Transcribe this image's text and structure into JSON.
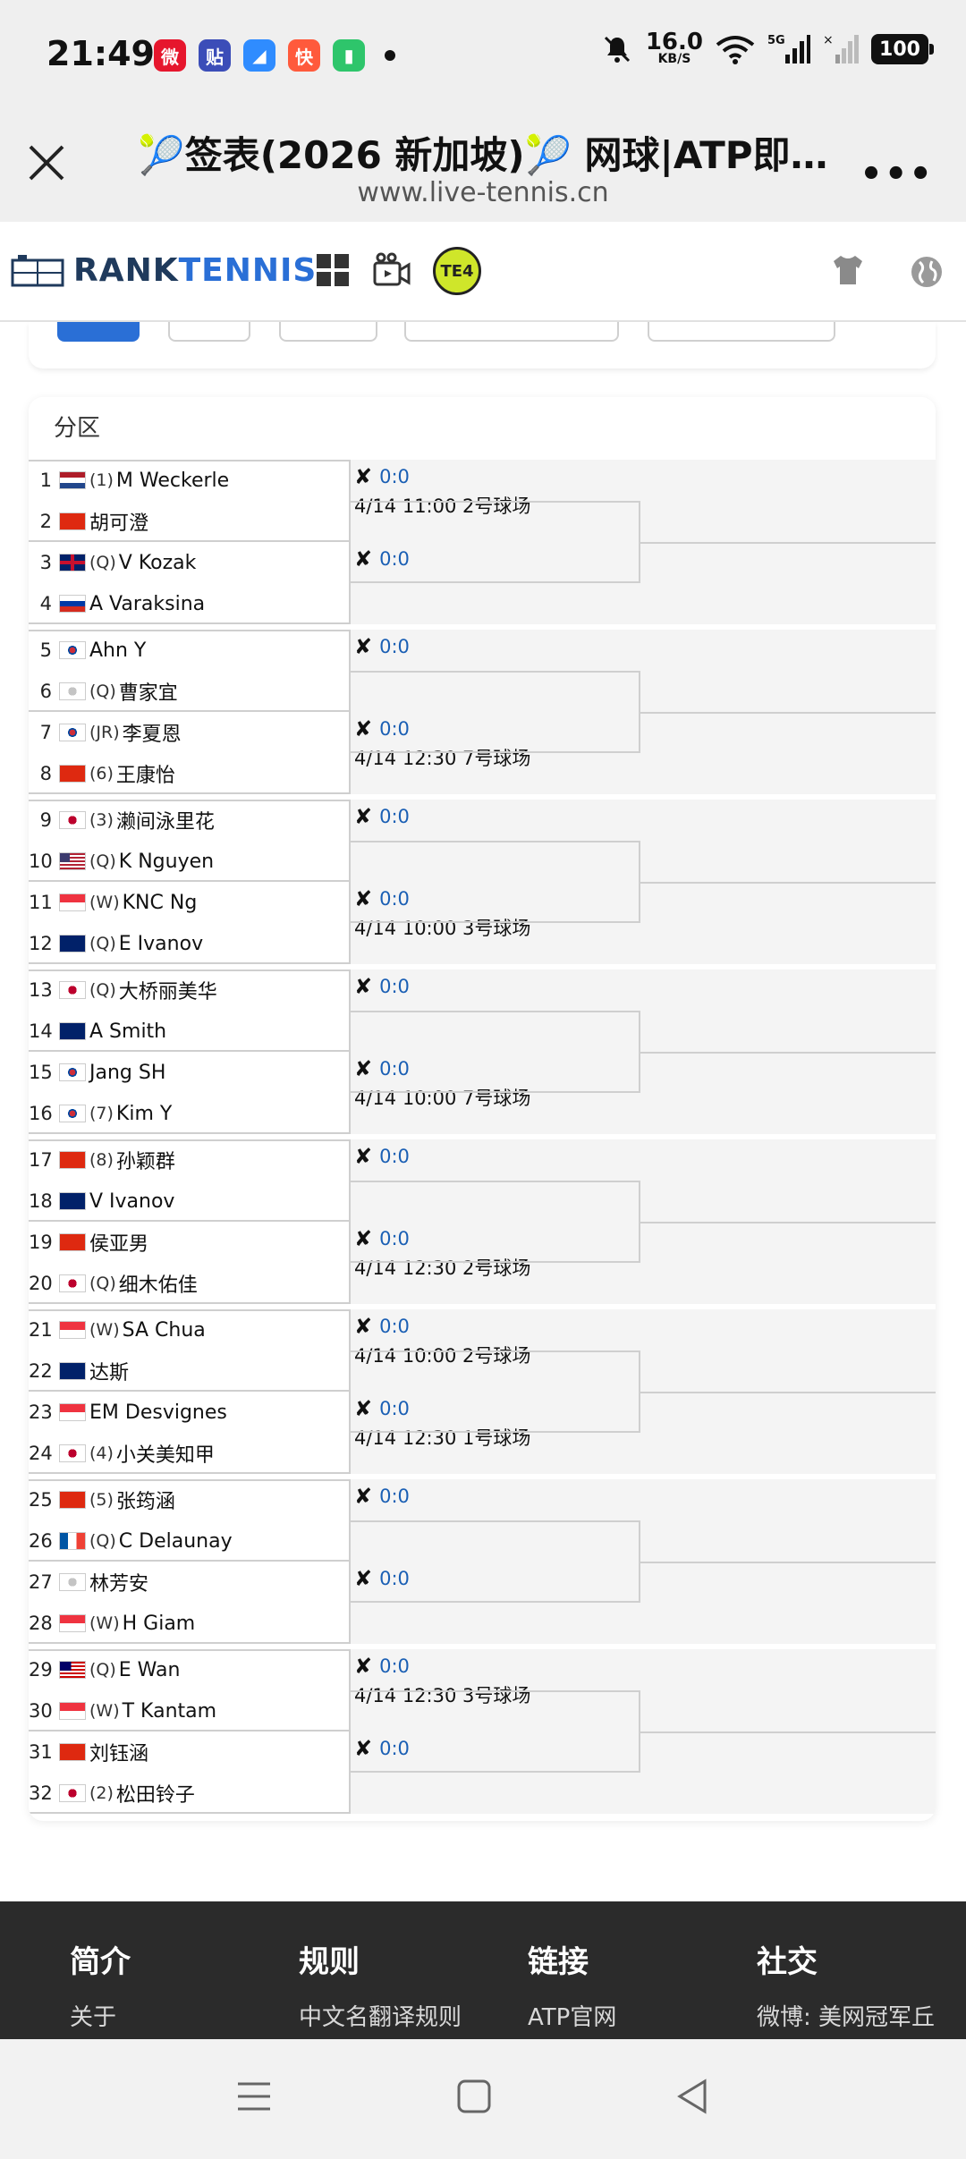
{
  "status": {
    "time": "21:49",
    "speed_value": "16.0",
    "speed_unit": "KB/S",
    "network": "5G",
    "battery": "100"
  },
  "browser": {
    "title": "🎾签表(2026 新加坡)🎾 网球|ATP即…",
    "url": "www.live-tennis.cn"
  },
  "site": {
    "logo_prefix": "RANK",
    "logo_suffix": "TENNIS",
    "badge": "TE4"
  },
  "bracket": {
    "heading": "分区",
    "score_default": "0:0",
    "players": [
      {
        "n": "1",
        "flag": "nl",
        "tag": "(1)",
        "name": "M Weckerle"
      },
      {
        "n": "2",
        "flag": "hk",
        "tag": "",
        "name": "胡可澄"
      },
      {
        "n": "3",
        "flag": "gb",
        "tag": "(Q)",
        "name": "V Kozak"
      },
      {
        "n": "4",
        "flag": "ru",
        "tag": "",
        "name": "A Varaksina"
      },
      {
        "n": "5",
        "flag": "kr",
        "tag": "",
        "name": "Ahn Y"
      },
      {
        "n": "6",
        "flag": "tw",
        "tag": "(Q)",
        "name": "曹家宜"
      },
      {
        "n": "7",
        "flag": "kr",
        "tag": "(JR)",
        "name": "李夏恩"
      },
      {
        "n": "8",
        "flag": "hk",
        "tag": "(6)",
        "name": "王康怡"
      },
      {
        "n": "9",
        "flag": "jp",
        "tag": "(3)",
        "name": "濑间泳里花"
      },
      {
        "n": "10",
        "flag": "us",
        "tag": "(Q)",
        "name": "K Nguyen"
      },
      {
        "n": "11",
        "flag": "sg",
        "tag": "(W)",
        "name": "KNC Ng"
      },
      {
        "n": "12",
        "flag": "au",
        "tag": "(Q)",
        "name": "E Ivanov"
      },
      {
        "n": "13",
        "flag": "jp",
        "tag": "(Q)",
        "name": "大桥丽美华"
      },
      {
        "n": "14",
        "flag": "au",
        "tag": "",
        "name": "A Smith"
      },
      {
        "n": "15",
        "flag": "kr",
        "tag": "",
        "name": "Jang SH"
      },
      {
        "n": "16",
        "flag": "kr",
        "tag": "(7)",
        "name": "Kim Y"
      },
      {
        "n": "17",
        "flag": "cn",
        "tag": "(8)",
        "name": "孙颖群"
      },
      {
        "n": "18",
        "flag": "nz",
        "tag": "",
        "name": "V Ivanov"
      },
      {
        "n": "19",
        "flag": "cn",
        "tag": "",
        "name": "侯亚男"
      },
      {
        "n": "20",
        "flag": "jp",
        "tag": "(Q)",
        "name": "细木佑佳"
      },
      {
        "n": "21",
        "flag": "sg",
        "tag": "(W)",
        "name": "SA Chua"
      },
      {
        "n": "22",
        "flag": "nz",
        "tag": "",
        "name": "达斯"
      },
      {
        "n": "23",
        "flag": "sg",
        "tag": "",
        "name": "EM Desvignes"
      },
      {
        "n": "24",
        "flag": "jp",
        "tag": "(4)",
        "name": "小关美知甲"
      },
      {
        "n": "25",
        "flag": "cn",
        "tag": "(5)",
        "name": "张筠涵"
      },
      {
        "n": "26",
        "flag": "fr",
        "tag": "(Q)",
        "name": "C Delaunay"
      },
      {
        "n": "27",
        "flag": "tw",
        "tag": "",
        "name": "林芳安"
      },
      {
        "n": "28",
        "flag": "sg",
        "tag": "(W)",
        "name": "H Giam"
      },
      {
        "n": "29",
        "flag": "my",
        "tag": "(Q)",
        "name": "E Wan"
      },
      {
        "n": "30",
        "flag": "sg",
        "tag": "(W)",
        "name": "T Kantam"
      },
      {
        "n": "31",
        "flag": "cn",
        "tag": "",
        "name": "刘钰涵"
      },
      {
        "n": "32",
        "flag": "jp",
        "tag": "(2)",
        "name": "松田铃子"
      }
    ],
    "schedules": [
      {
        "pair": 0,
        "text": "4/14 11:00 2号球场"
      },
      {
        "pair": 3,
        "text": "4/14 12:30 7号球场"
      },
      {
        "pair": 5,
        "text": "4/14 10:00 3号球场"
      },
      {
        "pair": 7,
        "text": "4/14 10:00 7号球场"
      },
      {
        "pair": 9,
        "text": "4/14 12:30 2号球场"
      },
      {
        "pair": 10,
        "text": "4/14 10:00 2号球场"
      },
      {
        "pair": 11,
        "text": "4/14 12:30 1号球场"
      },
      {
        "pair": 14,
        "text": "4/14 12:30 3号球场"
      }
    ]
  },
  "footer": {
    "columns": [
      {
        "heading": "简介",
        "link": "关于"
      },
      {
        "heading": "规则",
        "link": "中文名翻译规则"
      },
      {
        "heading": "链接",
        "link": "ATP官网"
      },
      {
        "heading": "社交",
        "link": "微博: 美网冠军丘"
      }
    ]
  },
  "colors": {
    "accent": "#2a6fd6",
    "score": "#1a5fb4",
    "footer_bg": "#2b2b2b"
  }
}
